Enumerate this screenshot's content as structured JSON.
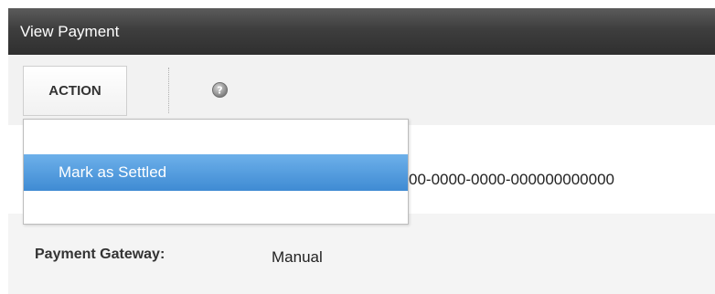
{
  "window": {
    "title": "View Payment"
  },
  "toolbar": {
    "action_label": "ACTION",
    "help_icon": "help-icon"
  },
  "dropdown": {
    "items": [
      {
        "label": "Mark as Settled",
        "highlighted": true
      }
    ]
  },
  "payment": {
    "id_value": "00-0000-0000-000000000000",
    "gateway_label": "Payment Gateway:",
    "gateway_value": "Manual"
  },
  "colors": {
    "highlight": "#4a97dc",
    "titlebar": "#3e3e3e"
  }
}
